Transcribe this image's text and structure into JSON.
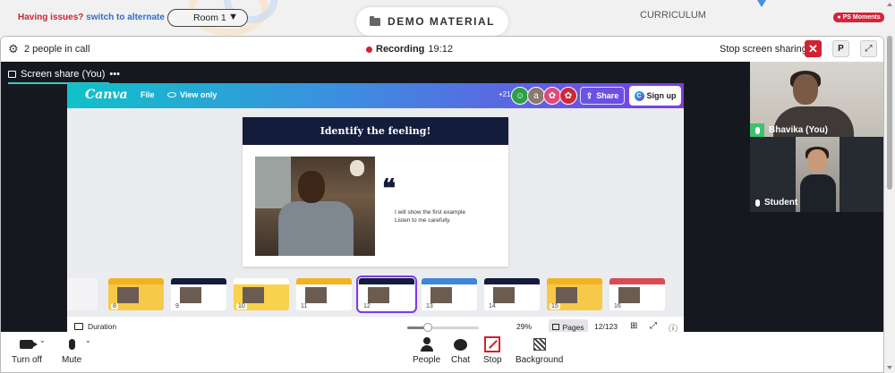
{
  "topbar": {
    "issues_text": "Having issues?",
    "switch_link": "switch to alternate room",
    "room_select": "Room 1",
    "demo_material": "DEMO MATERIAL",
    "curriculum": "CURRICULUM",
    "moments_badge": "PS Moments"
  },
  "callbar": {
    "people_count": "2 people in call",
    "recording_label": "Recording",
    "recording_time": "19:12",
    "stop_sharing": "Stop screen sharing",
    "p_button": "P"
  },
  "stage": {
    "share_tab": "Screen share (You)",
    "more": "•••"
  },
  "canva": {
    "logo": "Canva",
    "file": "File",
    "view_only": "View only",
    "collab_count": "+21",
    "avatar_letter": "a",
    "share": "Share",
    "signup": "Sign up",
    "slide": {
      "title": "Identify the feeling!",
      "quote_mark": "❝",
      "text_line1": "I will show the first example",
      "text_line2": "Listen to me carefully."
    },
    "thumbnails": [
      {
        "num": "8",
        "band": "#f2b322",
        "bg": "#f7c94a"
      },
      {
        "num": "9",
        "band": "#141c3c",
        "bg": "#ffffff"
      },
      {
        "num": "10",
        "band": "#ffffff",
        "bg": "#f9d24b"
      },
      {
        "num": "11",
        "band": "#f2b322",
        "bg": "#ffffff"
      },
      {
        "num": "12",
        "band": "#141c3c",
        "bg": "#ffffff"
      },
      {
        "num": "13",
        "band": "#3e86d8",
        "bg": "#ffffff"
      },
      {
        "num": "14",
        "band": "#141c3c",
        "bg": "#ffffff"
      },
      {
        "num": "15",
        "band": "#f2b322",
        "bg": "#f7c94a"
      },
      {
        "num": "16",
        "band": "#d84a55",
        "bg": "#ffffff"
      }
    ],
    "active_thumb": "12",
    "footer": {
      "duration": "Duration",
      "zoom": "29%",
      "zoom_fraction": 0.29,
      "pages": "Pages",
      "page_count": "12/123"
    }
  },
  "participants": [
    {
      "name": "Bhavika (You)"
    },
    {
      "name": "Student"
    }
  ],
  "toolbar": {
    "turn_off": "Turn off",
    "mute": "Mute",
    "people": "People",
    "chat": "Chat",
    "stop": "Stop",
    "background": "Background"
  },
  "colors": {
    "accent_red": "#d0232f",
    "canva_gradient_start": "#10c1c9",
    "canva_gradient_end": "#7a3de3",
    "slide_navy": "#141c3c",
    "tab_underline": "#3fc6c7",
    "mic_green": "#3cc36c"
  }
}
